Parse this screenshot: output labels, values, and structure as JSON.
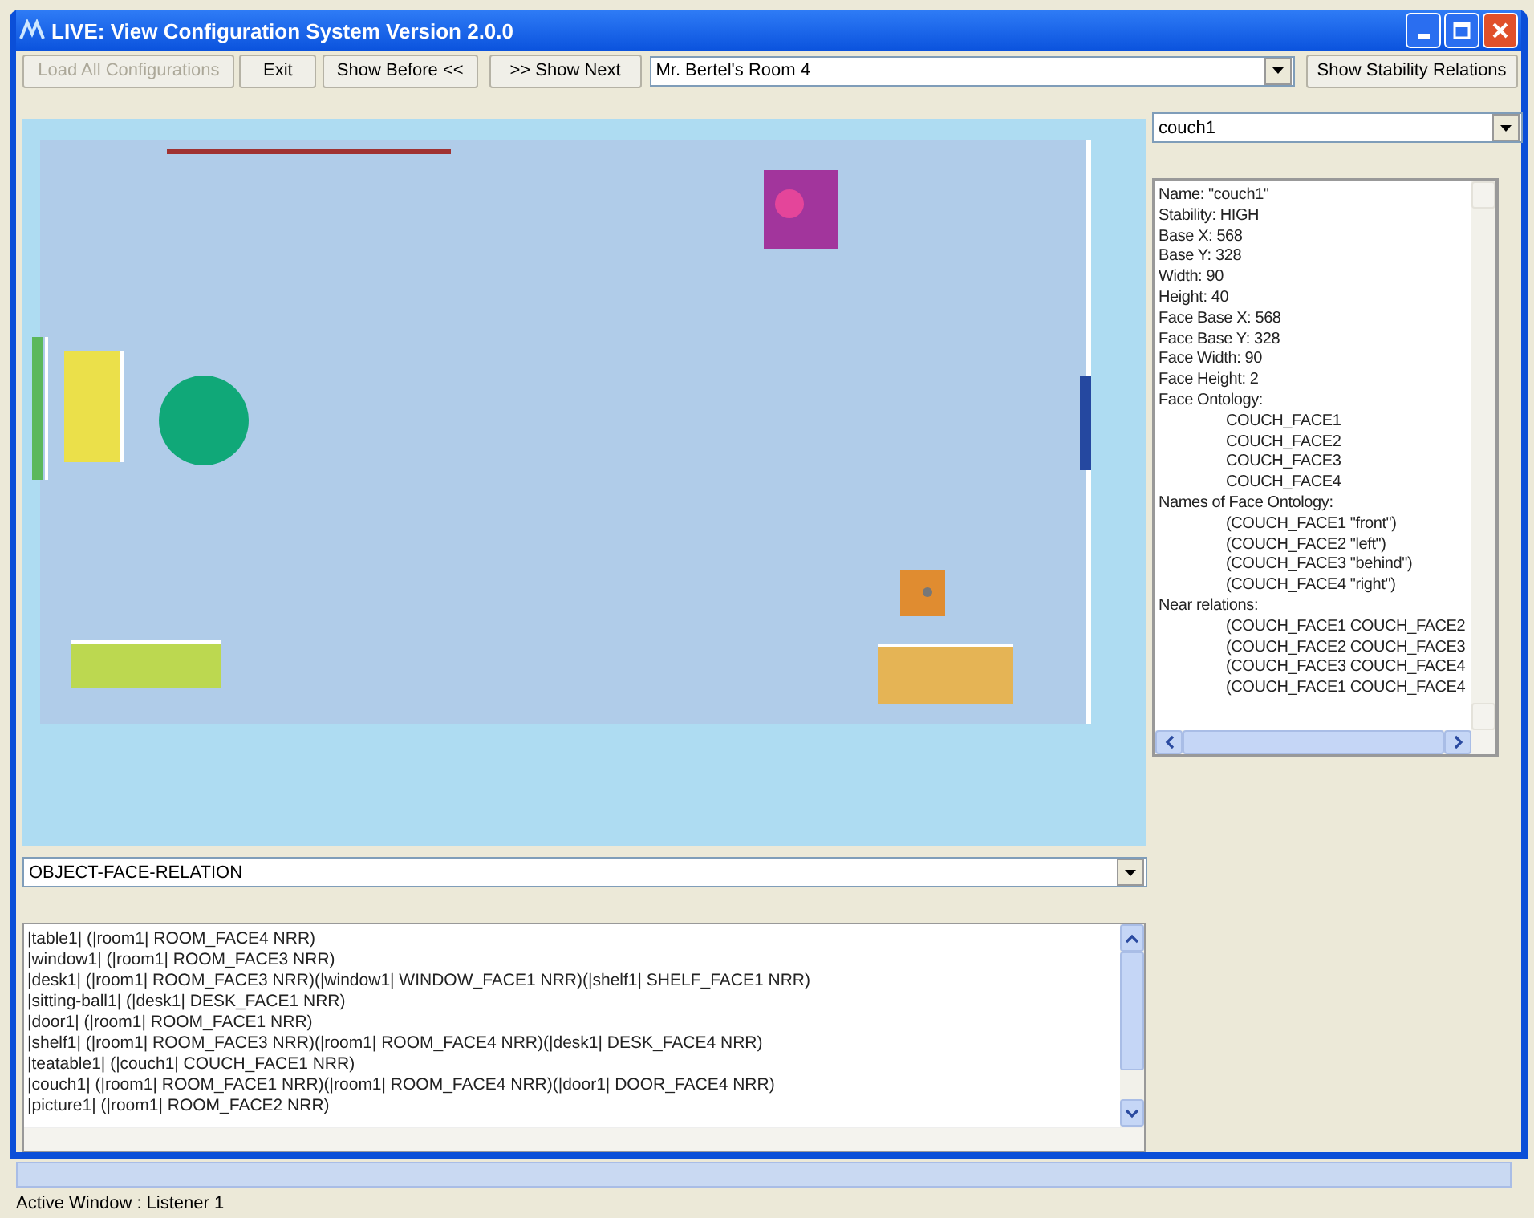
{
  "window": {
    "title": "LIVE: View Configuration System Version 2.0.0"
  },
  "toolbar": {
    "buttons": [
      {
        "label": "Load All Configurations",
        "disabled": true
      },
      {
        "label": "Exit",
        "disabled": false
      },
      {
        "label": "Show Before <<",
        "disabled": false
      },
      {
        "label": ">> Show Next",
        "disabled": false
      }
    ],
    "configuration_select": {
      "value": "Mr. Bertel's Room 4"
    },
    "relations_button": {
      "label": "Show Stability Relations"
    }
  },
  "object_select": {
    "value": "couch1"
  },
  "object_info": [
    {
      "text": "Name: \"couch1\""
    },
    {
      "text": "Stability: HIGH"
    },
    {
      "text": "Base X: 568"
    },
    {
      "text": "Base Y: 328"
    },
    {
      "text": "Width: 90"
    },
    {
      "text": "Height: 40"
    },
    {
      "text": "Face Base X: 568"
    },
    {
      "text": "Face Base Y: 328"
    },
    {
      "text": "Face Width: 90"
    },
    {
      "text": "Face Height: 2"
    },
    {
      "text": "Face Ontology:",
      "children": [
        {
          "text": "COUCH_FACE1"
        },
        {
          "text": "COUCH_FACE2"
        },
        {
          "text": "COUCH_FACE3"
        },
        {
          "text": "COUCH_FACE4"
        }
      ]
    },
    {
      "text": "Names of Face Ontology:",
      "children": [
        {
          "text": "(COUCH_FACE1 \"front\")"
        },
        {
          "text": "(COUCH_FACE2 \"left\")"
        },
        {
          "text": "(COUCH_FACE3 \"behind\")"
        },
        {
          "text": "(COUCH_FACE4 \"right\")"
        }
      ]
    },
    {
      "text": "Near relations:",
      "children": [
        {
          "text": "(COUCH_FACE1 COUCH_FACE2"
        },
        {
          "text": "(COUCH_FACE2 COUCH_FACE3"
        },
        {
          "text": "(COUCH_FACE3 COUCH_FACE4"
        },
        {
          "text": "(COUCH_FACE1 COUCH_FACE4"
        }
      ]
    }
  ],
  "relation_select": {
    "value": "OBJECT-FACE-RELATION"
  },
  "relation_rows": [
    "|table1| (|room1| ROOM_FACE4 NRR)",
    "|window1| (|room1| ROOM_FACE3 NRR)",
    "|desk1| (|room1| ROOM_FACE3 NRR)(|window1| WINDOW_FACE1 NRR)(|shelf1| SHELF_FACE1 NRR)",
    "|sitting-ball1| (|desk1| DESK_FACE1 NRR)",
    "|door1| (|room1| ROOM_FACE1 NRR)",
    "|shelf1| (|room1| ROOM_FACE3 NRR)(|room1| ROOM_FACE4 NRR)(|desk1| DESK_FACE4 NRR)",
    "|teatable1| (|couch1| COUCH_FACE1 NRR)",
    "|couch1| (|room1| ROOM_FACE1 NRR)(|room1| ROOM_FACE4 NRR)(|door1| DOOR_FACE4 NRR)",
    "|picture1| (|room1| ROOM_FACE2 NRR)"
  ],
  "status_bar": {
    "text": "Active Window : Listener 1"
  }
}
